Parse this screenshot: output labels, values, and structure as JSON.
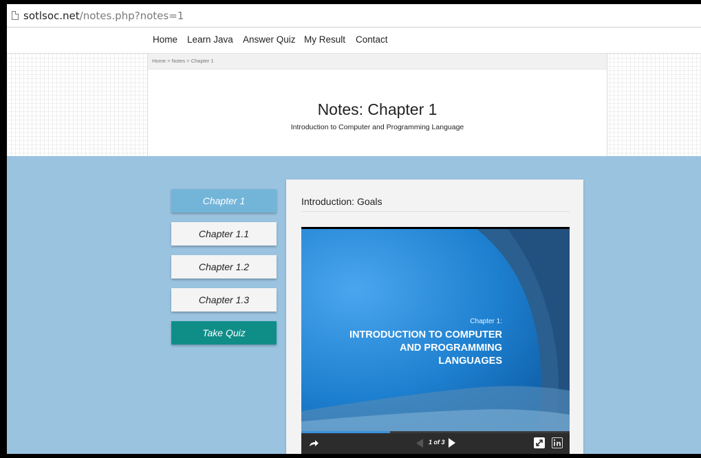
{
  "browser": {
    "url_domain": "sotlsoc.net",
    "url_path": "/notes.php?notes=1"
  },
  "nav": {
    "items": [
      "Home",
      "Learn Java",
      "Answer Quiz",
      "My Result",
      "Contact"
    ]
  },
  "breadcrumb": "Home > Notes > Chapter 1",
  "page": {
    "title": "Notes: Chapter 1",
    "subtitle": "Introduction to Computer and Programming Language"
  },
  "sidebar": {
    "items": [
      {
        "label": "Chapter 1",
        "state": "active"
      },
      {
        "label": "Chapter 1.1",
        "state": "normal"
      },
      {
        "label": "Chapter 1.2",
        "state": "normal"
      },
      {
        "label": "Chapter 1.3",
        "state": "normal"
      },
      {
        "label": "Take Quiz",
        "state": "quiz"
      }
    ]
  },
  "content": {
    "title": "Introduction: Goals",
    "slide": {
      "kicker": "Chapter 1:",
      "heading_lines": [
        "INTRODUCTION TO COMPUTER",
        "AND PROGRAMMING",
        "LANGUAGES"
      ],
      "progress": 0.33
    },
    "player": {
      "page_indicator": "1 of 3",
      "icons": [
        "share-icon",
        "prev-icon",
        "next-icon",
        "fullscreen-icon",
        "linkedin-icon"
      ]
    }
  },
  "colors": {
    "active": "#73b5d9",
    "quiz": "#0f8e88",
    "background": "#9ac3e0"
  }
}
